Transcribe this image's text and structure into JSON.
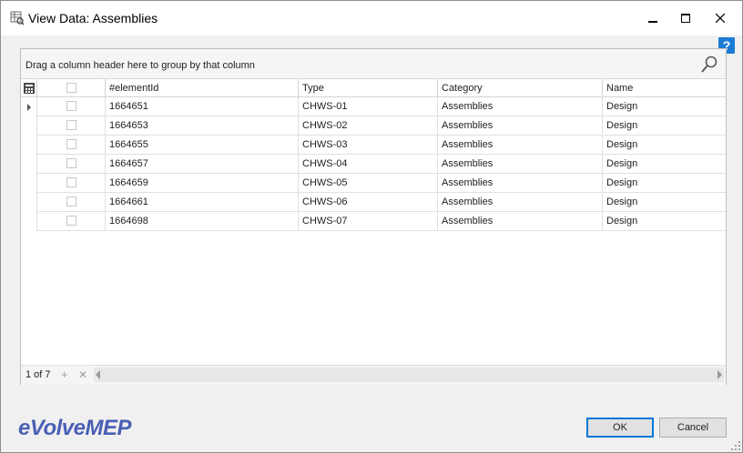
{
  "window": {
    "title": "View Data: Assemblies"
  },
  "group_panel": {
    "text": "Drag a column header here to group by that column"
  },
  "columns": [
    "#elementId",
    "Type",
    "Category",
    "Name"
  ],
  "rows": [
    {
      "elementId": "1664651",
      "type": "CHWS-01",
      "category": "Assemblies",
      "name": "Design"
    },
    {
      "elementId": "1664653",
      "type": "CHWS-02",
      "category": "Assemblies",
      "name": "Design"
    },
    {
      "elementId": "1664655",
      "type": "CHWS-03",
      "category": "Assemblies",
      "name": "Design"
    },
    {
      "elementId": "1664657",
      "type": "CHWS-04",
      "category": "Assemblies",
      "name": "Design"
    },
    {
      "elementId": "1664659",
      "type": "CHWS-05",
      "category": "Assemblies",
      "name": "Design"
    },
    {
      "elementId": "1664661",
      "type": "CHWS-06",
      "category": "Assemblies",
      "name": "Design"
    },
    {
      "elementId": "1664698",
      "type": "CHWS-07",
      "category": "Assemblies",
      "name": "Design"
    }
  ],
  "pager": {
    "text": "1 of 7"
  },
  "logo": "eVolveMEP",
  "buttons": {
    "ok": "OK",
    "cancel": "Cancel"
  },
  "help": {
    "glyph": "?"
  }
}
